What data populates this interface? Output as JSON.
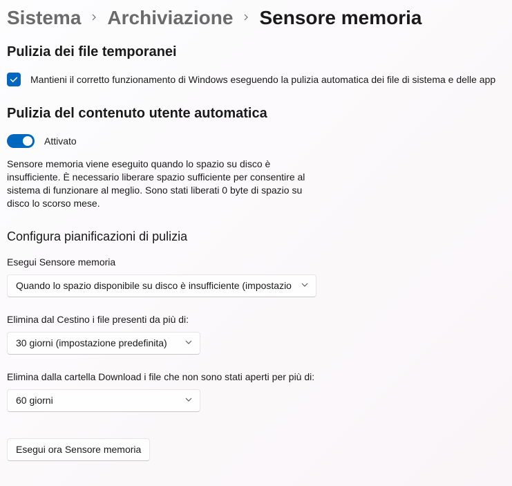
{
  "breadcrumb": {
    "root": "Sistema",
    "mid": "Archiviazione",
    "current": "Sensore memoria"
  },
  "sections": {
    "temp": {
      "title": "Pulizia dei file temporanei",
      "checkbox_label": "Mantieni il corretto funzionamento di Windows eseguendo la pulizia automatica dei file di sistema e delle app"
    },
    "auto": {
      "title": "Pulizia del contenuto utente automatica",
      "toggle_state": "Attivato",
      "description": "Sensore memoria viene eseguito quando lo spazio su disco è insufficiente. È necessario liberare spazio sufficiente per consentire al sistema di funzionare al meglio. Sono stati liberati 0 byte di spazio su disco lo scorso mese."
    },
    "schedule": {
      "title": "Configura pianificazioni di pulizia",
      "run_label": "Esegui Sensore memoria",
      "run_value": "Quando lo spazio disponibile su disco è insufficiente (impostazio",
      "recycle_label": "Elimina dal Cestino i file presenti da più di:",
      "recycle_value": "30 giorni (impostazione predefinita)",
      "downloads_label": "Elimina dalla cartella Download i file che non sono stati aperti per più di:",
      "downloads_value": "60 giorni"
    },
    "run_now_button": "Esegui ora Sensore memoria"
  },
  "colors": {
    "accent": "#0067c0"
  }
}
